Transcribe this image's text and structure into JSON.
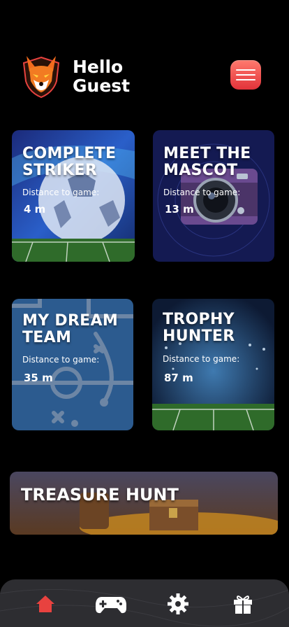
{
  "header": {
    "greeting_line1": "Hello",
    "greeting_line2": "Guest",
    "logo_icon": "fox-mascot-logo",
    "menu_icon": "hamburger-menu-icon"
  },
  "cards": [
    {
      "title": "COMPLETE STRIKER",
      "distance_label": "Distance to game:",
      "distance_value": "4 m",
      "image": "soccer-ball-stadium"
    },
    {
      "title": "MEET THE MASCOT",
      "distance_label": "Distance to game:",
      "distance_value": "13 m",
      "image": "camera"
    },
    {
      "title": "MY DREAM TEAM",
      "distance_label": "Distance to game:",
      "distance_value": "35 m",
      "image": "tactics-board"
    },
    {
      "title": "TROPHY HUNTER",
      "distance_label": "Distance to game:",
      "distance_value": "87 m",
      "image": "stadium-lights"
    }
  ],
  "banner": {
    "title": "TREASURE HUNT",
    "image": "treasure-chest-gold"
  },
  "nav": {
    "active": "home",
    "items": [
      "home-icon",
      "gamepad-icon",
      "gear-icon",
      "gift-icon"
    ]
  },
  "colors": {
    "accent": "#e8423f",
    "navbar": "#2d2d31",
    "background": "#000000"
  }
}
